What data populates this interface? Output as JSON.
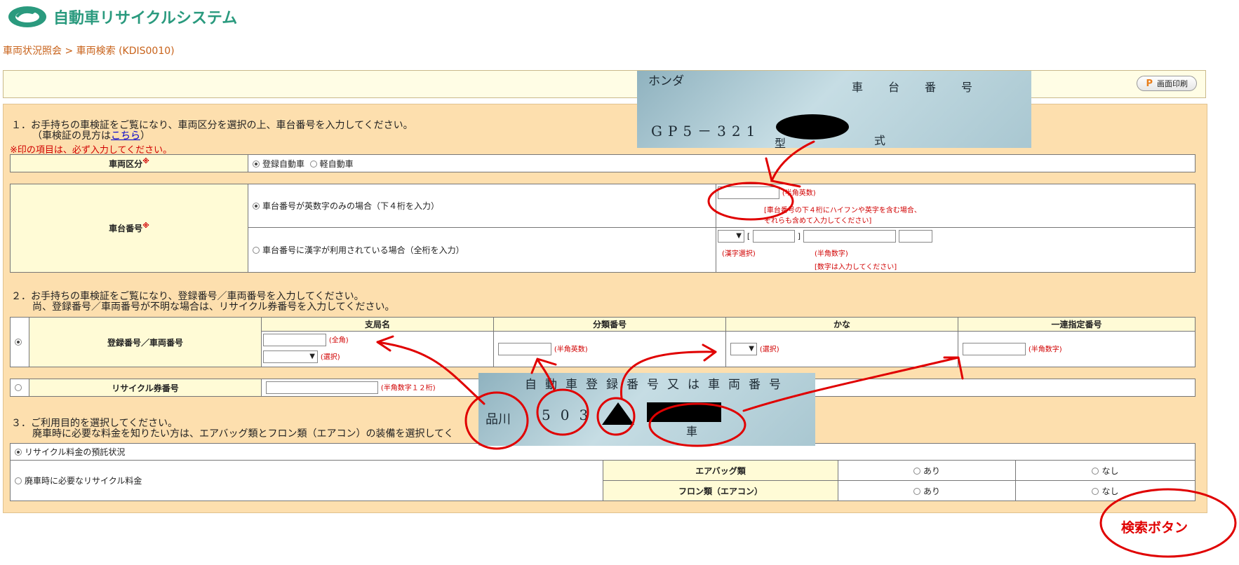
{
  "app": {
    "title": "自動車リサイクルシステム"
  },
  "breadcrumb": "車両状況照会 > 車両検索 (KDIS0010)",
  "print_button": {
    "label": "画面印刷"
  },
  "section1": {
    "title": "１．お手持ちの車検証をご覧になり、車両区分を選択の上、車台番号を入力してください。",
    "howto_prefix": "（車検証の見方は",
    "howto_link": "こちら",
    "howto_suffix": "）",
    "required_note": "※印の項目は、必ず入力してください。"
  },
  "vehicle_type": {
    "label": "車両区分",
    "options": [
      "登録自動車",
      "軽自動車"
    ]
  },
  "chassis": {
    "label": "車台番号",
    "option_alnum": "車台番号が英数字のみの場合（下４桁を入力）",
    "alnum_note": "(半角英数)",
    "alnum_hint1": "[車台番号の下４桁にハイフンや英字を含む場合、",
    "alnum_hint2": "それらも含めて入力してください]",
    "option_kanji": "車台番号に漢字が利用されている場合（全桁を入力）",
    "kanji_select_note": "(漢字選択)",
    "digits_note": "(半角数字)",
    "digits_hint": "[数字は入力してください]"
  },
  "section2": {
    "line1": "２．お手持ちの車検証をご覧になり、登録番号／車両番号を入力してください。",
    "line2": "尚、登録番号／車両番号が不明な場合は、リサイクル券番号を入力してください。"
  },
  "registration": {
    "label": "登録番号／車両番号",
    "headers": [
      "支局名",
      "分類番号",
      "かな",
      "一連指定番号"
    ],
    "branch_note": "(全角)",
    "branch_select_note": "(選択)",
    "class_note": "(半角英数)",
    "kana_note": "(選択)",
    "serial_note": "(半角数字)"
  },
  "recycle_ticket": {
    "label": "リサイクル券番号",
    "note": "(半角数字１２桁)"
  },
  "section3": {
    "line1": "３．ご利用目的を選択してください。",
    "line2": "廃車時に必要な料金を知りたい方は、エアバッグ類とフロン類（エアコン）の装備を選択してく"
  },
  "purpose": {
    "option_deposit": "リサイクル料金の預託状況",
    "option_scrap": "廃車時に必要なリサイクル料金",
    "airbag_label": "エアバッグ類",
    "freon_label": "フロン類（エアコン）",
    "yes": "あり",
    "no": "なし"
  },
  "photo1": {
    "maker": "ホンダ",
    "caption": "車台番号",
    "number": "GP5－321",
    "type1": "型",
    "type2": "式"
  },
  "photo2": {
    "caption": "自動車登録番号又は車両番号",
    "branch": "品川",
    "class": "503",
    "vehicle": "車"
  },
  "search_button": {
    "label": "検索ボタン"
  },
  "colors": {
    "accent": "#2a9a7e",
    "breadcrumb": "#c8621a",
    "form_bg": "#fddfae",
    "label_bg": "#fffbd6",
    "annotation": "#e00000"
  }
}
